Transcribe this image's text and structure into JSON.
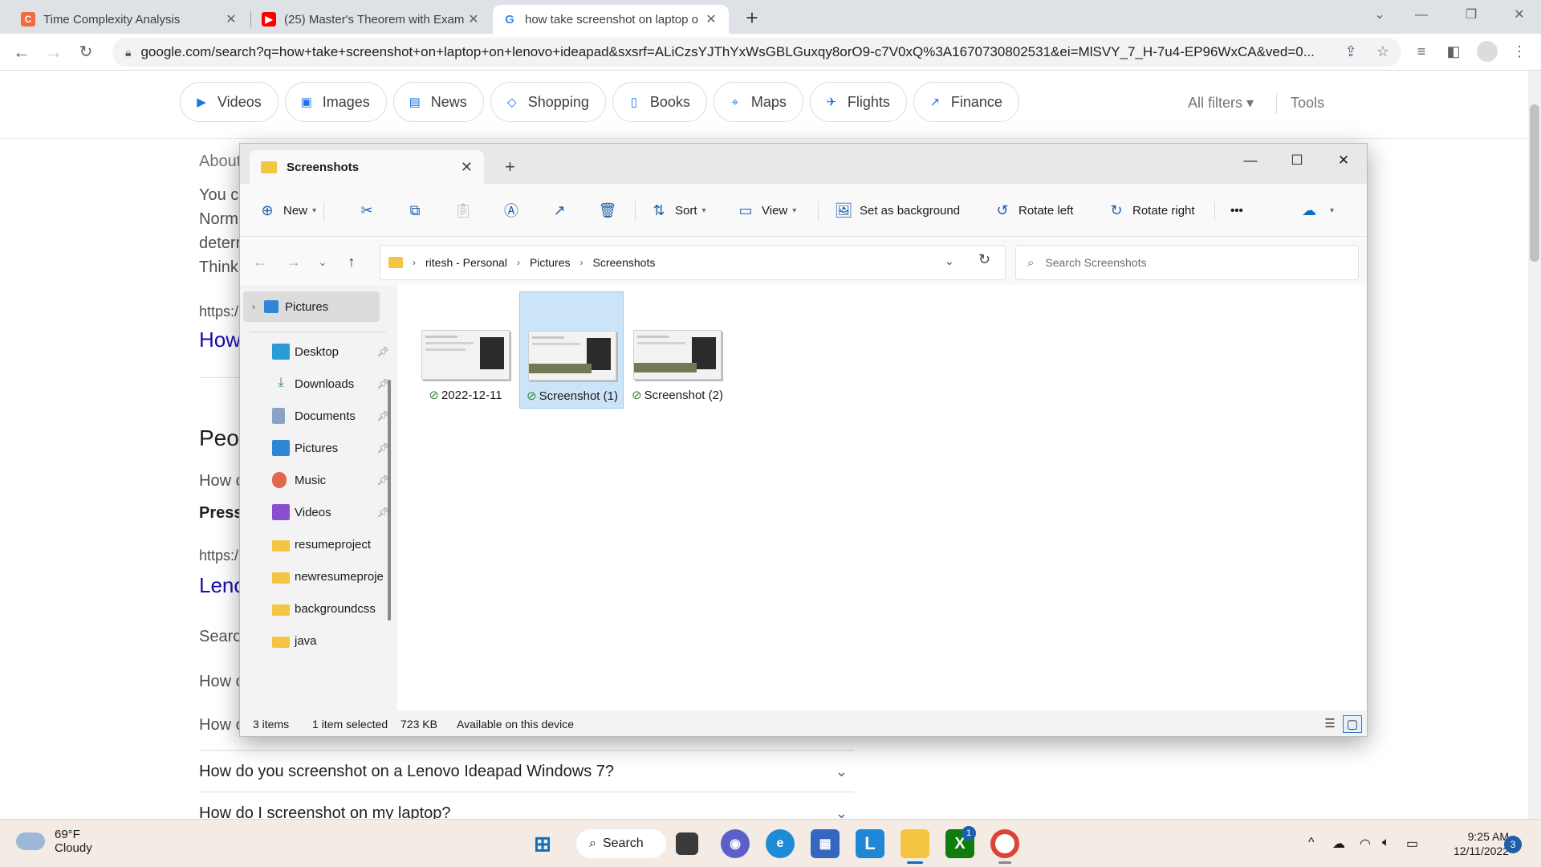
{
  "browser": {
    "tabs": [
      {
        "title": "Time Complexity Analysis",
        "icon": "codingninjas-favicon",
        "color": "#f26b3a"
      },
      {
        "title": "(25) Master's Theorem with Exam",
        "icon": "youtube-favicon",
        "color": "#ff0000"
      },
      {
        "title": "how take screenshot on laptop o",
        "icon": "google-favicon",
        "color": "#4285f4"
      }
    ],
    "url": "google.com/search?q=how+take+screenshot+on+laptop+on+lenovo+ideapad&sxsrf=ALiCzsYJThYxWsGBLGuxqy8orO9-c7V0xQ%3A1670730802531&ei=MlSVY_7_H-7u4-EP96WxCA&ved=0..."
  },
  "google": {
    "chips": [
      {
        "label": "Videos",
        "icon": "play-icon"
      },
      {
        "label": "Images",
        "icon": "image-icon"
      },
      {
        "label": "News",
        "icon": "news-icon"
      },
      {
        "label": "Shopping",
        "icon": "tag-icon"
      },
      {
        "label": "Books",
        "icon": "book-icon"
      },
      {
        "label": "Maps",
        "icon": "pin-icon"
      },
      {
        "label": "Flights",
        "icon": "plane-icon"
      },
      {
        "label": "Finance",
        "icon": "chart-icon"
      }
    ],
    "all_filters": "All filters",
    "tools": "Tools",
    "fragments": {
      "about": "About",
      "you": "You c",
      "norm": "Norm",
      "deter": "deterr",
      "think": "Think",
      "https1": "https:/",
      "how_link": "How",
      "people": "Peop",
      "how2": "How c",
      "press": "Press",
      "https2": "https:/",
      "lenovo": "Leno",
      "search": "Searc",
      "how3": "How c",
      "how4": "How c"
    },
    "questions": [
      "How do you screenshot on a Lenovo Ideapad Windows 7?",
      "How do I screenshot on my laptop?"
    ]
  },
  "explorer": {
    "tab_title": "Screenshots",
    "commands": {
      "new": "New",
      "sort": "Sort",
      "view": "View",
      "set_background": "Set as background",
      "rotate_left": "Rotate left",
      "rotate_right": "Rotate right",
      "more": "•••"
    },
    "breadcrumb": [
      "ritesh - Personal",
      "Pictures",
      "Screenshots"
    ],
    "search_placeholder": "Search Screenshots",
    "nav_top": "Pictures",
    "nav_items": [
      {
        "label": "Desktop",
        "icon": "desktop-icon",
        "pinned": true
      },
      {
        "label": "Downloads",
        "icon": "download-icon",
        "pinned": true
      },
      {
        "label": "Documents",
        "icon": "document-icon",
        "pinned": true
      },
      {
        "label": "Pictures",
        "icon": "pictures-icon",
        "pinned": true
      },
      {
        "label": "Music",
        "icon": "music-icon",
        "pinned": true
      },
      {
        "label": "Videos",
        "icon": "videos-icon",
        "pinned": true
      },
      {
        "label": "resumeproject",
        "icon": "folder-icon",
        "pinned": false
      },
      {
        "label": "newresumeproje",
        "icon": "folder-icon",
        "pinned": false
      },
      {
        "label": "backgroundcss",
        "icon": "folder-icon",
        "pinned": false
      },
      {
        "label": "java",
        "icon": "folder-icon",
        "pinned": false
      }
    ],
    "files": [
      {
        "name": "2022-12-11",
        "selected": false
      },
      {
        "name": "Screenshot (1)",
        "selected": true
      },
      {
        "name": "Screenshot (2)",
        "selected": false
      }
    ],
    "status": {
      "items": "3 items",
      "selected": "1 item selected",
      "size": "723 KB",
      "availability": "Available on this device"
    }
  },
  "taskbar": {
    "temperature": "69°F",
    "condition": "Cloudy",
    "search_label": "Search",
    "time": "9:25 AM",
    "date": "12/11/2022",
    "notifications": "3",
    "xbox_badge": "1"
  }
}
